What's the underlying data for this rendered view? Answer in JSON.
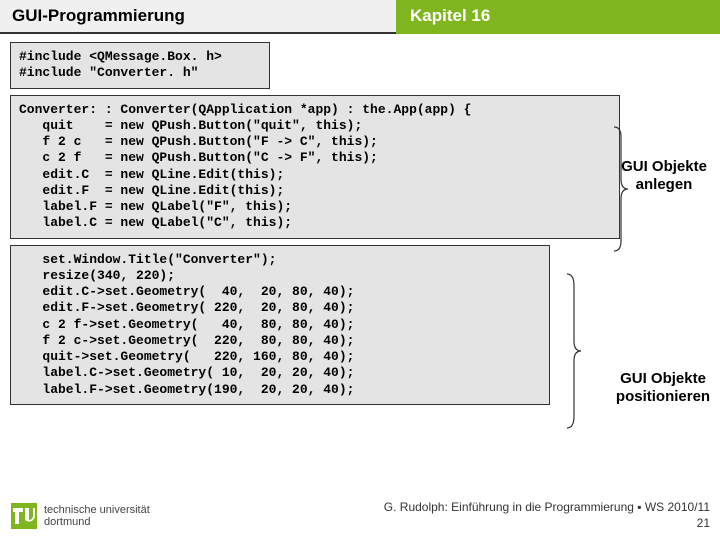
{
  "header": {
    "left": "GUI-Programmierung",
    "right": "Kapitel 16"
  },
  "code": {
    "includes": "#include <QMessage.Box. h>\n#include \"Converter. h\"",
    "ctor": "Converter: : Converter(QApplication *app) : the.App(app) {\n   quit    = new QPush.Button(\"quit\", this);\n   f 2 c   = new QPush.Button(\"F -> C\", this);\n   c 2 f   = new QPush.Button(\"C -> F\", this);\n   edit.C  = new QLine.Edit(this);\n   edit.F  = new QLine.Edit(this);\n   label.F = new QLabel(\"F\", this);\n   label.C = new QLabel(\"C\", this);",
    "geom": "   set.Window.Title(\"Converter\");\n   resize(340, 220);\n   edit.C->set.Geometry(  40,  20, 80, 40);\n   edit.F->set.Geometry( 220,  20, 80, 40);\n   c 2 f->set.Geometry(   40,  80, 80, 40);\n   f 2 c->set.Geometry(  220,  80, 80, 40);\n   quit->set.Geometry(   220, 160, 80, 40);\n   label.C->set.Geometry( 10,  20, 20, 40);\n   label.F->set.Geometry(190,  20, 20, 40);"
  },
  "notes": {
    "objects_create_l1": "GUI Objekte",
    "objects_create_l2": "anlegen",
    "objects_position_l1": "GUI Objekte",
    "objects_position_l2": "positionieren"
  },
  "footer": {
    "uni_l1": "technische universität",
    "uni_l2": "dortmund",
    "credit": "G. Rudolph: Einführung in die Programmierung ▪ WS 2010/11",
    "page": "21"
  },
  "colors": {
    "accent": "#7fb620"
  }
}
